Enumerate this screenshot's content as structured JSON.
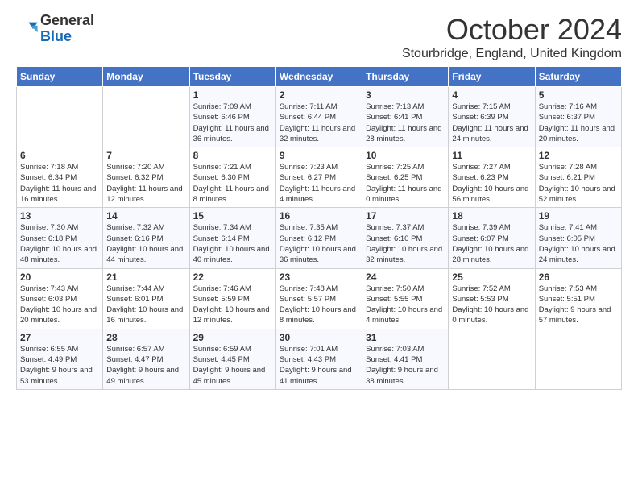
{
  "logo": {
    "general": "General",
    "blue": "Blue"
  },
  "header": {
    "month": "October 2024",
    "location": "Stourbridge, England, United Kingdom"
  },
  "days_of_week": [
    "Sunday",
    "Monday",
    "Tuesday",
    "Wednesday",
    "Thursday",
    "Friday",
    "Saturday"
  ],
  "weeks": [
    [
      {
        "day": "",
        "info": ""
      },
      {
        "day": "",
        "info": ""
      },
      {
        "day": "1",
        "info": "Sunrise: 7:09 AM\nSunset: 6:46 PM\nDaylight: 11 hours and 36 minutes."
      },
      {
        "day": "2",
        "info": "Sunrise: 7:11 AM\nSunset: 6:44 PM\nDaylight: 11 hours and 32 minutes."
      },
      {
        "day": "3",
        "info": "Sunrise: 7:13 AM\nSunset: 6:41 PM\nDaylight: 11 hours and 28 minutes."
      },
      {
        "day": "4",
        "info": "Sunrise: 7:15 AM\nSunset: 6:39 PM\nDaylight: 11 hours and 24 minutes."
      },
      {
        "day": "5",
        "info": "Sunrise: 7:16 AM\nSunset: 6:37 PM\nDaylight: 11 hours and 20 minutes."
      }
    ],
    [
      {
        "day": "6",
        "info": "Sunrise: 7:18 AM\nSunset: 6:34 PM\nDaylight: 11 hours and 16 minutes."
      },
      {
        "day": "7",
        "info": "Sunrise: 7:20 AM\nSunset: 6:32 PM\nDaylight: 11 hours and 12 minutes."
      },
      {
        "day": "8",
        "info": "Sunrise: 7:21 AM\nSunset: 6:30 PM\nDaylight: 11 hours and 8 minutes."
      },
      {
        "day": "9",
        "info": "Sunrise: 7:23 AM\nSunset: 6:27 PM\nDaylight: 11 hours and 4 minutes."
      },
      {
        "day": "10",
        "info": "Sunrise: 7:25 AM\nSunset: 6:25 PM\nDaylight: 11 hours and 0 minutes."
      },
      {
        "day": "11",
        "info": "Sunrise: 7:27 AM\nSunset: 6:23 PM\nDaylight: 10 hours and 56 minutes."
      },
      {
        "day": "12",
        "info": "Sunrise: 7:28 AM\nSunset: 6:21 PM\nDaylight: 10 hours and 52 minutes."
      }
    ],
    [
      {
        "day": "13",
        "info": "Sunrise: 7:30 AM\nSunset: 6:18 PM\nDaylight: 10 hours and 48 minutes."
      },
      {
        "day": "14",
        "info": "Sunrise: 7:32 AM\nSunset: 6:16 PM\nDaylight: 10 hours and 44 minutes."
      },
      {
        "day": "15",
        "info": "Sunrise: 7:34 AM\nSunset: 6:14 PM\nDaylight: 10 hours and 40 minutes."
      },
      {
        "day": "16",
        "info": "Sunrise: 7:35 AM\nSunset: 6:12 PM\nDaylight: 10 hours and 36 minutes."
      },
      {
        "day": "17",
        "info": "Sunrise: 7:37 AM\nSunset: 6:10 PM\nDaylight: 10 hours and 32 minutes."
      },
      {
        "day": "18",
        "info": "Sunrise: 7:39 AM\nSunset: 6:07 PM\nDaylight: 10 hours and 28 minutes."
      },
      {
        "day": "19",
        "info": "Sunrise: 7:41 AM\nSunset: 6:05 PM\nDaylight: 10 hours and 24 minutes."
      }
    ],
    [
      {
        "day": "20",
        "info": "Sunrise: 7:43 AM\nSunset: 6:03 PM\nDaylight: 10 hours and 20 minutes."
      },
      {
        "day": "21",
        "info": "Sunrise: 7:44 AM\nSunset: 6:01 PM\nDaylight: 10 hours and 16 minutes."
      },
      {
        "day": "22",
        "info": "Sunrise: 7:46 AM\nSunset: 5:59 PM\nDaylight: 10 hours and 12 minutes."
      },
      {
        "day": "23",
        "info": "Sunrise: 7:48 AM\nSunset: 5:57 PM\nDaylight: 10 hours and 8 minutes."
      },
      {
        "day": "24",
        "info": "Sunrise: 7:50 AM\nSunset: 5:55 PM\nDaylight: 10 hours and 4 minutes."
      },
      {
        "day": "25",
        "info": "Sunrise: 7:52 AM\nSunset: 5:53 PM\nDaylight: 10 hours and 0 minutes."
      },
      {
        "day": "26",
        "info": "Sunrise: 7:53 AM\nSunset: 5:51 PM\nDaylight: 9 hours and 57 minutes."
      }
    ],
    [
      {
        "day": "27",
        "info": "Sunrise: 6:55 AM\nSunset: 4:49 PM\nDaylight: 9 hours and 53 minutes."
      },
      {
        "day": "28",
        "info": "Sunrise: 6:57 AM\nSunset: 4:47 PM\nDaylight: 9 hours and 49 minutes."
      },
      {
        "day": "29",
        "info": "Sunrise: 6:59 AM\nSunset: 4:45 PM\nDaylight: 9 hours and 45 minutes."
      },
      {
        "day": "30",
        "info": "Sunrise: 7:01 AM\nSunset: 4:43 PM\nDaylight: 9 hours and 41 minutes."
      },
      {
        "day": "31",
        "info": "Sunrise: 7:03 AM\nSunset: 4:41 PM\nDaylight: 9 hours and 38 minutes."
      },
      {
        "day": "",
        "info": ""
      },
      {
        "day": "",
        "info": ""
      }
    ]
  ]
}
